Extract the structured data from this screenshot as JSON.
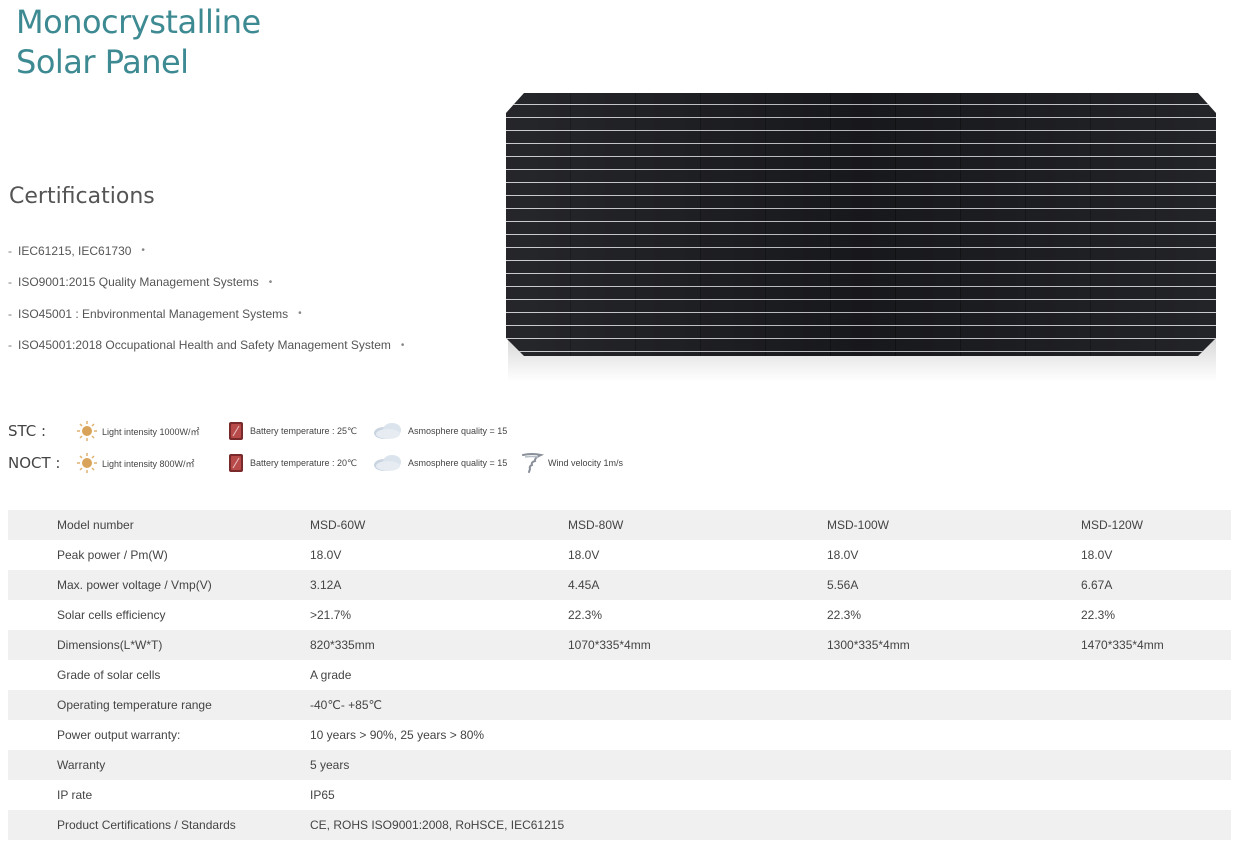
{
  "title": {
    "line1": "Monocrystalline",
    "line2": "Solar Panel"
  },
  "colors": {
    "accent": "#3d8a92",
    "row_stripe": "#f0f0f0",
    "text": "#444444"
  },
  "certifications": {
    "heading": "Certifications",
    "items": [
      "IEC61215, IEC61730",
      "ISO9001:2015 Quality Management Systems",
      "ISO45001 : Enbvironmental Management Systems",
      "ISO45001:2018 Occupational Health and Safety Management System"
    ]
  },
  "conditions": {
    "stc": {
      "label": "STC :",
      "light": "Light intensity 1000W/㎡",
      "battery": "Battery temperature : 25℃",
      "atmosphere": "Asmosphere quality = 15"
    },
    "noct": {
      "label": "NOCT :",
      "light": "Light intensity 800W/㎡",
      "battery": "Battery temperature : 20℃",
      "atmosphere": "Asmosphere quality = 15",
      "wind": "Wind velocity 1m/s"
    },
    "icons": [
      "sun-icon",
      "battery-icon",
      "cloud-icon",
      "wind-icon"
    ]
  },
  "specs": {
    "rows": [
      [
        "Model number",
        "MSD-60W",
        "MSD-80W",
        "MSD-100W",
        "MSD-120W"
      ],
      [
        "Peak power / Pm(W)",
        "18.0V",
        "18.0V",
        "18.0V",
        "18.0V"
      ],
      [
        "Max. power voltage / Vmp(V)",
        "3.12A",
        "4.45A",
        "5.56A",
        "6.67A"
      ],
      [
        "Solar cells efficiency",
        ">21.7%",
        "22.3%",
        "22.3%",
        "22.3%"
      ],
      [
        "Dimensions(L*W*T)",
        "820*335mm",
        "1070*335*4mm",
        "1300*335*4mm",
        "1470*335*4mm"
      ],
      [
        "Grade of solar cells",
        "A grade",
        "",
        "",
        ""
      ],
      [
        "Operating temperature range",
        "-40℃- +85℃",
        "",
        "",
        ""
      ],
      [
        "Power output warranty:",
        "10 years > 90%, 25 years > 80%",
        "",
        "",
        ""
      ],
      [
        "Warranty",
        "5 years",
        "",
        "",
        ""
      ],
      [
        "IP rate",
        "IP65",
        "",
        "",
        ""
      ],
      [
        "Product Certifications / Standards",
        "CE, ROHS ISO9001:2008, RoHSCE, IEC61215",
        "",
        "",
        ""
      ]
    ]
  }
}
